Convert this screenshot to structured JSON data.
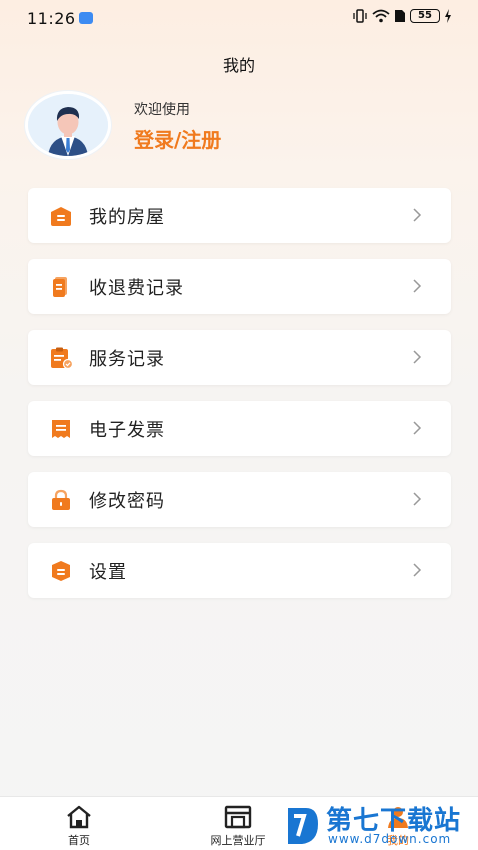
{
  "status_bar": {
    "time": "11:26",
    "battery": "55"
  },
  "header": {
    "title": "我的"
  },
  "profile": {
    "welcome": "欢迎使用",
    "login_label": "登录/注册"
  },
  "menu": {
    "items": [
      {
        "label": "我的房屋",
        "icon": "house-icon"
      },
      {
        "label": "收退费记录",
        "icon": "receipt-icon"
      },
      {
        "label": "服务记录",
        "icon": "clipboard-icon"
      },
      {
        "label": "电子发票",
        "icon": "invoice-icon"
      },
      {
        "label": "修改密码",
        "icon": "lock-icon"
      },
      {
        "label": "设置",
        "icon": "settings-icon"
      }
    ]
  },
  "bottom_nav": {
    "items": [
      {
        "label": "首页",
        "icon": "home-icon"
      },
      {
        "label": "网上营业厅",
        "icon": "store-icon"
      },
      {
        "label": "我的",
        "icon": "user-icon",
        "active": true
      }
    ]
  },
  "watermark": {
    "title": "第七下载站",
    "url": "www.d7down.com"
  },
  "colors": {
    "accent": "#f07a1e",
    "watermark": "#1976d2"
  }
}
